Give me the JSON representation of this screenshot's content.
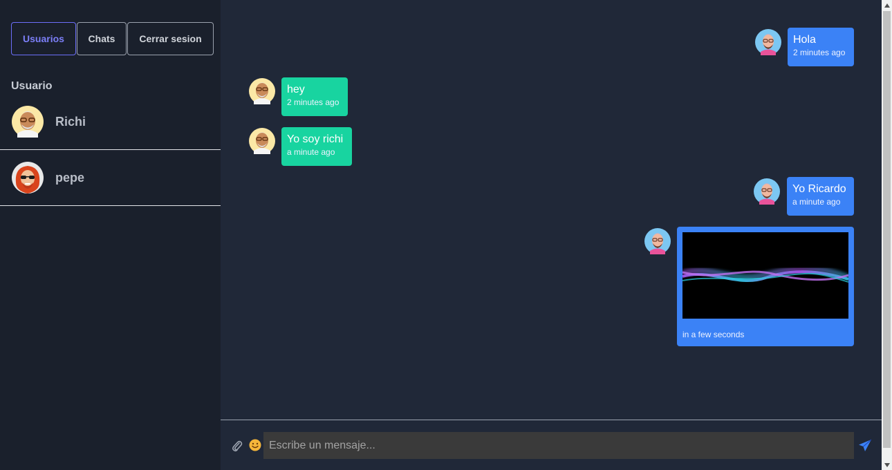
{
  "sidebar": {
    "tabs": [
      {
        "label": "Usuarios",
        "active": true
      },
      {
        "label": "Chats",
        "active": false
      },
      {
        "label": "Cerrar sesion",
        "active": false
      }
    ],
    "section_title": "Usuario",
    "users": [
      {
        "name": "Richi",
        "avatar": "avatar-bald-man-glasses"
      },
      {
        "name": "pepe",
        "avatar": "avatar-red-hair-sunglasses"
      }
    ]
  },
  "chat": {
    "messages": [
      {
        "direction": "outgoing",
        "text": "Hola",
        "time": "2 minutes ago"
      },
      {
        "direction": "incoming",
        "text": "hey",
        "time": "2 minutes ago"
      },
      {
        "direction": "incoming",
        "text": "Yo soy richi",
        "time": "a minute ago"
      },
      {
        "direction": "outgoing",
        "text": "Yo Ricardo",
        "time": "a minute ago"
      },
      {
        "direction": "outgoing",
        "type": "video",
        "time": "in a few seconds"
      }
    ]
  },
  "composer": {
    "placeholder": "Escribe un mensaje...",
    "attach_icon": "paperclip-icon",
    "emoji_icon": "smiley-icon",
    "send_icon": "paper-plane-icon"
  },
  "colors": {
    "outgoing_bubble": "#3b82f6",
    "incoming_bubble": "#18d4a0",
    "active_tab": "#6d6ffc"
  }
}
